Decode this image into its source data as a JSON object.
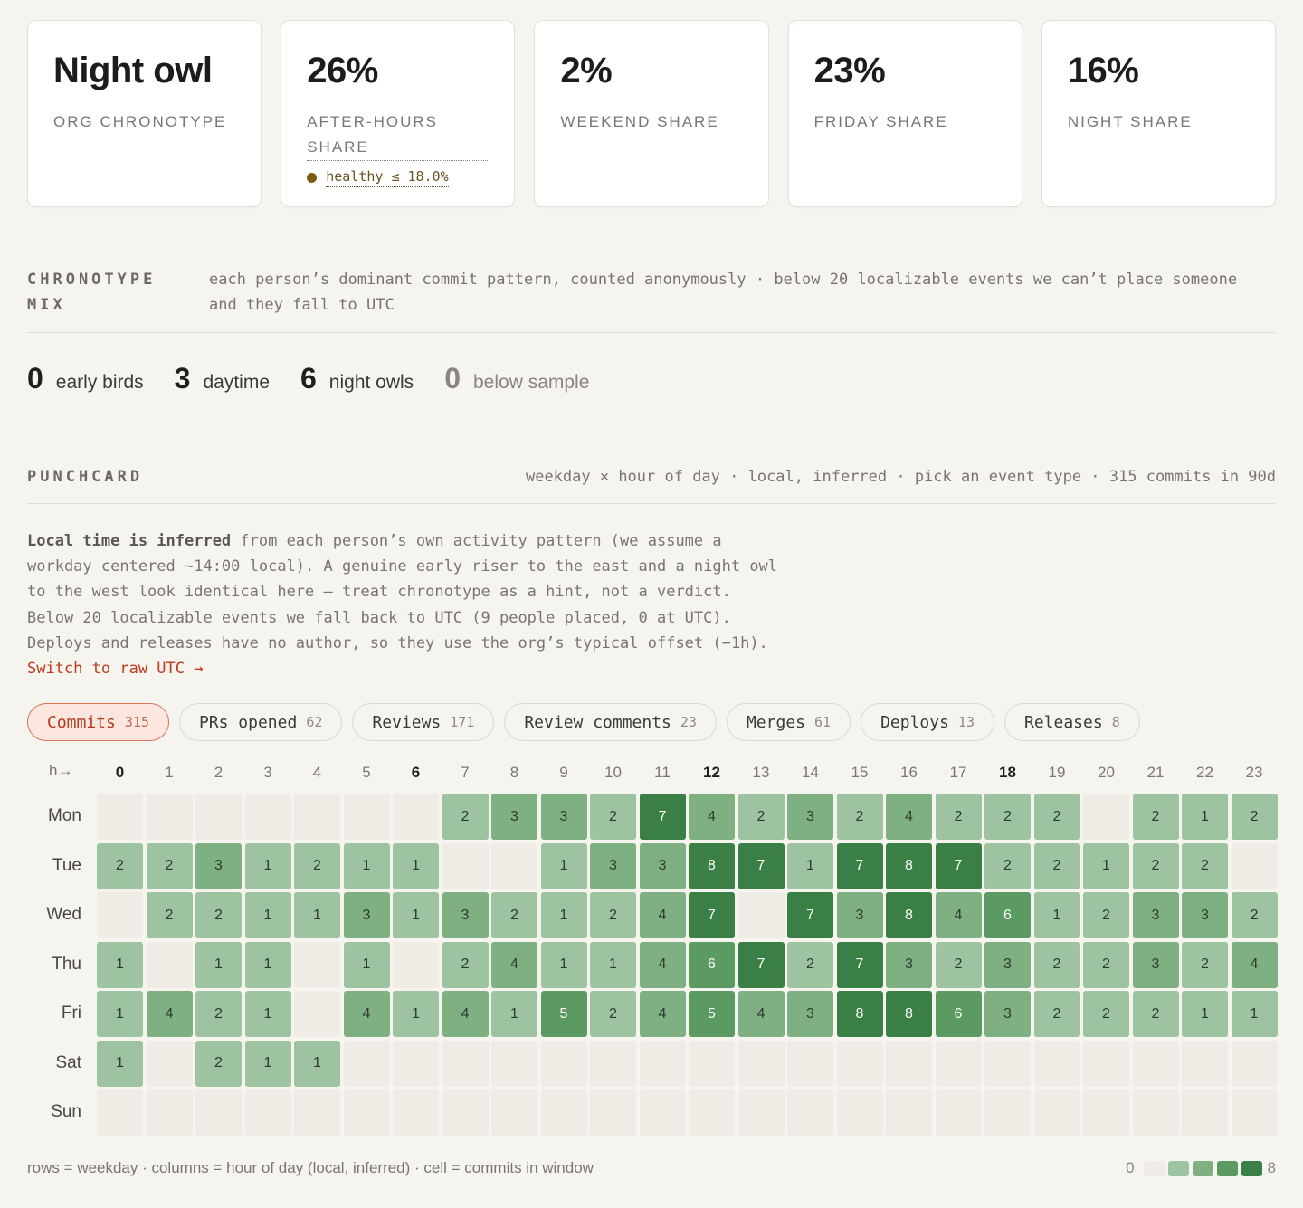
{
  "cards": [
    {
      "value": "Night owl",
      "label": "ORG CHRONOTYPE"
    },
    {
      "value": "26%",
      "label": "AFTER-HOURS SHARE",
      "note": "healthy ≤ 18.0%"
    },
    {
      "value": "2%",
      "label": "WEEKEND SHARE"
    },
    {
      "value": "23%",
      "label": "FRIDAY SHARE"
    },
    {
      "value": "16%",
      "label": "NIGHT SHARE"
    }
  ],
  "chronotype": {
    "title": "CHRONOTYPE MIX",
    "desc": "each person’s dominant commit pattern, counted anonymously · below 20 localizable events we can’t place someone and they fall to UTC",
    "mix": [
      {
        "num": "0",
        "label": "early birds"
      },
      {
        "num": "3",
        "label": "daytime"
      },
      {
        "num": "6",
        "label": "night owls"
      },
      {
        "num": "0",
        "label": "below sample"
      }
    ]
  },
  "punchcard": {
    "title": "PUNCHCARD",
    "desc": "weekday × hour of day · local, inferred · pick an event type · 315 commits in 90d",
    "note_bold": "Local time is inferred",
    "note_text": " from each person’s own activity pattern (we assume a workday centered ~14:00 local). A genuine early riser to the east and a night owl to the west look identical here — treat chronotype as a hint, not a verdict. Below 20 localizable events we fall back to UTC (9 people placed, 0 at UTC). Deploys and releases have no author, so they use the org’s typical offset (−1h). ",
    "note_link": "Switch to raw UTC →",
    "tabs": [
      {
        "label": "Commits",
        "count": "315",
        "active": true
      },
      {
        "label": "PRs opened",
        "count": "62"
      },
      {
        "label": "Reviews",
        "count": "171"
      },
      {
        "label": "Review comments",
        "count": "23"
      },
      {
        "label": "Merges",
        "count": "61"
      },
      {
        "label": "Deploys",
        "count": "13"
      },
      {
        "label": "Releases",
        "count": "8"
      }
    ],
    "hour_corner": "h→",
    "bold_hours": [
      0,
      6,
      12,
      18
    ],
    "days": [
      "Mon",
      "Tue",
      "Wed",
      "Thu",
      "Fri",
      "Sat",
      "Sun"
    ],
    "hours": [
      0,
      1,
      2,
      3,
      4,
      5,
      6,
      7,
      8,
      9,
      10,
      11,
      12,
      13,
      14,
      15,
      16,
      17,
      18,
      19,
      20,
      21,
      22,
      23
    ],
    "values": [
      [
        0,
        0,
        0,
        0,
        0,
        0,
        0,
        2,
        3,
        3,
        2,
        7,
        4,
        2,
        3,
        2,
        4,
        2,
        2,
        2,
        0,
        2,
        1,
        2
      ],
      [
        2,
        2,
        3,
        1,
        2,
        1,
        1,
        0,
        0,
        1,
        3,
        3,
        8,
        7,
        1,
        7,
        8,
        7,
        2,
        2,
        1,
        2,
        2,
        0
      ],
      [
        0,
        2,
        2,
        1,
        1,
        3,
        1,
        3,
        2,
        1,
        2,
        4,
        7,
        0,
        7,
        3,
        8,
        4,
        6,
        1,
        2,
        3,
        3,
        2
      ],
      [
        1,
        0,
        1,
        1,
        0,
        1,
        0,
        2,
        4,
        1,
        1,
        4,
        6,
        7,
        2,
        7,
        3,
        2,
        3,
        2,
        2,
        3,
        2,
        4
      ],
      [
        1,
        4,
        2,
        1,
        0,
        4,
        1,
        4,
        1,
        5,
        2,
        4,
        5,
        4,
        3,
        8,
        8,
        6,
        3,
        2,
        2,
        2,
        1,
        1
      ],
      [
        1,
        0,
        2,
        1,
        1,
        0,
        0,
        0,
        0,
        0,
        0,
        0,
        0,
        0,
        0,
        0,
        0,
        0,
        0,
        0,
        0,
        0,
        0,
        0
      ],
      [
        0,
        0,
        0,
        0,
        0,
        0,
        0,
        0,
        0,
        0,
        0,
        0,
        0,
        0,
        0,
        0,
        0,
        0,
        0,
        0,
        0,
        0,
        0,
        0
      ]
    ],
    "max": 8,
    "colors": {
      "empty": "#efece5",
      "l1": "#9dc3a0",
      "l2": "#7fb082",
      "l3": "#5c9a63",
      "l4": "#3a7f45"
    },
    "footer": "rows = weekday · columns = hour of day (local, inferred) · cell = commits in window",
    "legend_min": "0",
    "legend_max": "8"
  }
}
